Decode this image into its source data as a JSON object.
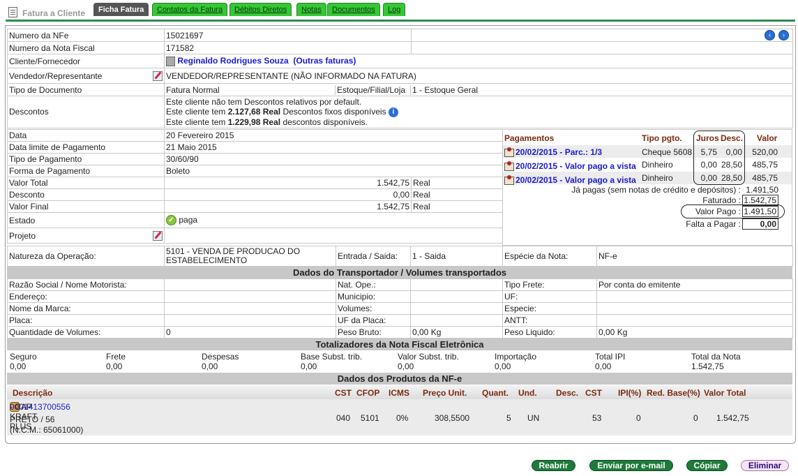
{
  "app": {
    "title": "Fatura a Cliente",
    "tabs": [
      "Ficha Fatura",
      "Contatos da Fatura",
      "Débitos Diretos",
      "Notas",
      "Documentos",
      "Log"
    ],
    "nav_prev": "‹",
    "nav_next": "›"
  },
  "fields": {
    "nfe_label": "Numero da NFe",
    "nfe_value": "15021697",
    "nf_label": "Numero da Nota Fiscal",
    "nf_value": "171582",
    "cliente_label": "Cliente/Fornecedor",
    "cliente_name": "Reginaldo Rodrigues Souza",
    "cliente_outras": "(Outras faturas)",
    "vendedor_label": "Vendedor/Representante",
    "vendedor_value": "VENDEDOR/REPRESENTANTE (NÃO INFORMADO NA FATURA)",
    "tipo_doc_label": "Tipo de Documento",
    "tipo_doc_value": "Fatura Normal",
    "estoque_label": "Estoque/Filial/Loja",
    "estoque_value": "1 - Estoque Geral",
    "descontos_label": "Descontos",
    "desc_line1": "Este cliente não tem Descontos relativos por default.",
    "desc_line2_pre": "Este cliente tem ",
    "desc_line2_amount": "2.127,68 Real",
    "desc_line2_post": " Descontos fixos disponíveis",
    "desc_line3_pre": "Este cliente tem ",
    "desc_line3_amount": "1.229,98 Real",
    "desc_line3_post": " descontos disponíveis.",
    "data_label": "Data",
    "data_value": "20 Fevereiro 2015",
    "data_limite_label": "Data limite de Pagamento",
    "data_limite_value": "21 Maio 2015",
    "tipo_pag_label": "Tipo de Pagamento",
    "tipo_pag_value": "30/60/90",
    "forma_pag_label": "Forma de Pagamento",
    "forma_pag_value": "Boleto",
    "valor_total_label": "Valor Total",
    "valor_total_value": "1.542,75",
    "currency": "Real",
    "desconto_label": "Desconto",
    "desconto_value": "0,00",
    "valor_final_label": "Valor Final",
    "valor_final_value": "1.542,75",
    "estado_label": "Estado",
    "estado_value": "paga",
    "projeto_label": "Projeto",
    "natureza_label": "Natureza da Operação:",
    "natureza_value": "5101 - VENDA DE PRODUCAO DO ESTABELECIMENTO",
    "entrada_label": "Entrada / Saida:",
    "entrada_value": "1 - Saida",
    "especie_label": "Espécie da Nota:",
    "especie_value": "NF-e"
  },
  "payments": {
    "header": {
      "title": "Pagamentos",
      "tipo": "Tipo pgto.",
      "juros": "Juros",
      "desc": "Desc.",
      "valor": "Valor"
    },
    "rows": [
      {
        "label": "20/02/2015 - Parc.: 1/3",
        "tipo": "Cheque 5608",
        "juros": "5,75",
        "desc": "0,00",
        "valor": "520,00"
      },
      {
        "label": "20/02/2015 - Valor pago a vista",
        "tipo": "Dinheiro",
        "juros": "0,00",
        "desc": "28,50",
        "valor": "485,75"
      },
      {
        "label": "20/02/2015 - Valor pago a vista",
        "tipo": "Dinheiro",
        "juros": "0,00",
        "desc": "28,50",
        "valor": "485,75"
      }
    ],
    "ja_pagas_label": "Já pagas (sem notas de crédito e depósitos) :",
    "ja_pagas_value": "1.491,50",
    "faturado_label": "Faturado :",
    "faturado_value": "1.542,75",
    "valor_pago_label": "Valor Pago :",
    "valor_pago_value": "1.491,50",
    "falta_label": "Falta a Pagar :",
    "falta_value": "0,00"
  },
  "transport": {
    "section_title": "Dados do Transportador / Volumes transportados",
    "razao_label": "Razão Social / Nome Motorista:",
    "nat_ope_label": "Nat. Ope.:",
    "tipo_frete_label": "Tipo Frete:",
    "tipo_frete_value": "Por conta do emitente",
    "endereco_label": "Endereço:",
    "municipio_label": "Municipio:",
    "uf_label": "UF:",
    "marca_label": "Nome da Marca:",
    "volumes_label": "Volumes:",
    "especie_label": "Especie:",
    "placa_label": "Placa:",
    "uf_placa_label": "UF da Placa:",
    "antt_label": "ANTT:",
    "qtd_label": "Quantidade de Volumes:",
    "qtd_value": "0",
    "peso_bruto_label": "Peso Bruto:",
    "peso_bruto_value": "0,00 Kg",
    "peso_liq_label": "Peso Liquido:",
    "peso_liq_value": "0,00 Kg"
  },
  "totals": {
    "section_title": "Totalizadores da Nota Fiscal Eletrônica",
    "items": [
      {
        "label": "Seguro",
        "value": "0,00"
      },
      {
        "label": "Frete",
        "value": "0,00"
      },
      {
        "label": "Despesas",
        "value": "0,00"
      },
      {
        "label": "Base Subst. trib.",
        "value": "0,00"
      },
      {
        "label": "Valor Subst. trib.",
        "value": "0,00"
      },
      {
        "label": "Importação",
        "value": "0,00"
      },
      {
        "label": "Total IPI",
        "value": "0,00"
      },
      {
        "label": "Total da Nota",
        "value": "1.542,75"
      }
    ]
  },
  "products": {
    "section_title": "Dados dos Produtos da NF-e",
    "headers": {
      "descricao": "Descrição",
      "cst": "CST",
      "cfop": "CFOP",
      "icms": "ICMS",
      "preco": "Preço Unit.",
      "quant": "Quant.",
      "und": "Und.",
      "desc": "Desc.",
      "cst2": "CST",
      "ipi": "IPI(%)",
      "red": "Red. Base(%)",
      "valor": "Valor Total"
    },
    "row": {
      "code": "0001413700556",
      "name": " - CAP KRAFT PLUS",
      "line2": "PRETO / 56",
      "line3": "(N.C.M.: 65061000)",
      "cst": "040",
      "cfop": "5101",
      "icms": "0%",
      "preco": "308,5500",
      "quant": "5",
      "und": "UN",
      "desc": "",
      "cst2": "53",
      "ipi": "0",
      "red": "0",
      "valor": "1.542,75"
    }
  },
  "buttons": {
    "reabrir": "Reabrir",
    "enviar": "Enviar por e-mail",
    "copiar": "Cópiar",
    "eliminar": "Eliminar"
  }
}
